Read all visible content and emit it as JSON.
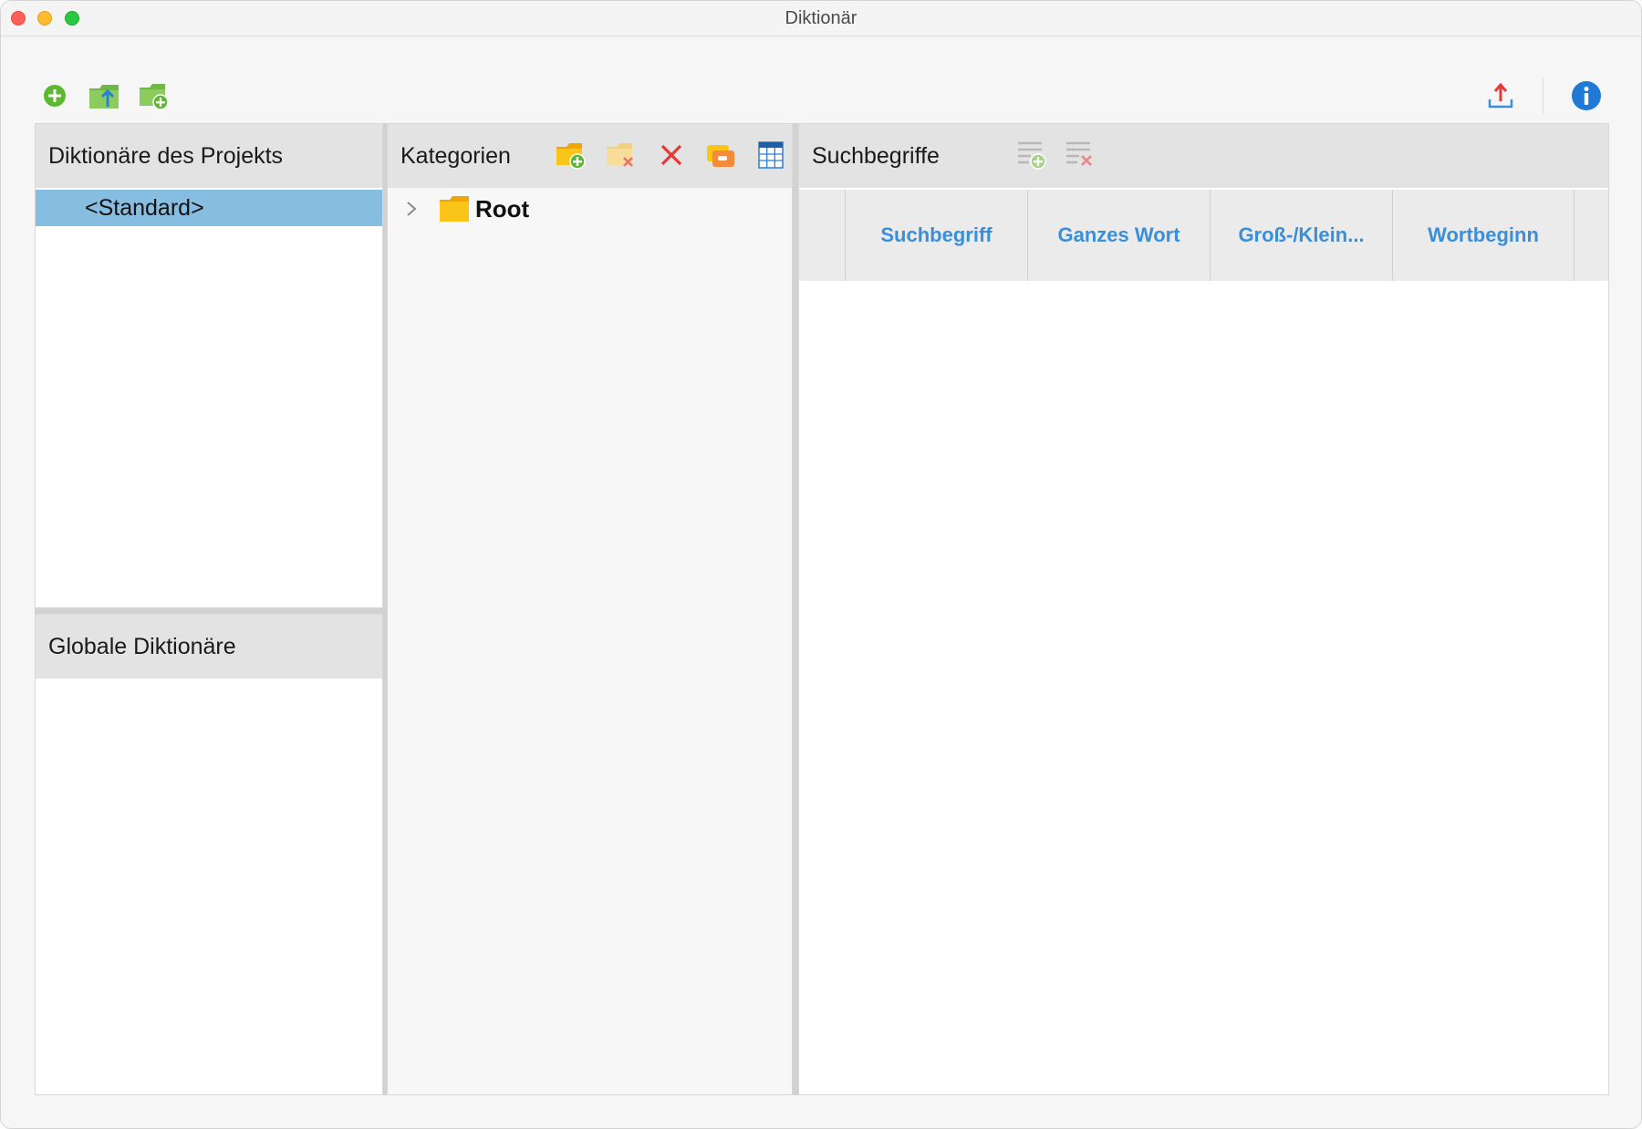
{
  "window": {
    "title": "Diktionär"
  },
  "toolbar": {
    "left_icons": [
      "add-circle-icon",
      "folder-upload-icon",
      "folder-add-icon"
    ],
    "right_icons": [
      "export-icon",
      "info-icon"
    ]
  },
  "projects_panel": {
    "header": "Diktionäre des Projekts",
    "items": [
      "<Standard>"
    ],
    "selected": "<Standard>"
  },
  "global_panel": {
    "header": "Globale Diktionäre",
    "items": []
  },
  "categories_panel": {
    "header": "Kategorien",
    "icons": [
      "folder-add-icon",
      "folder-remove-icon",
      "delete-icon",
      "folder-rename-icon",
      "table-icon"
    ],
    "tree": [
      {
        "label": "Root",
        "expanded": false
      }
    ]
  },
  "terms_panel": {
    "header": "Suchbegriffe",
    "icons": [
      "list-add-icon",
      "list-remove-icon"
    ],
    "columns": [
      "Suchbegriff",
      "Ganzes Wort",
      "Groß-/Klein...",
      "Wortbeginn"
    ],
    "rows": []
  },
  "colors": {
    "selection": "#87bde1",
    "column_header_text": "#3b8ed8",
    "accent_green": "#5cb82e",
    "accent_red": "#e53935",
    "info_blue": "#1e7ad6"
  }
}
